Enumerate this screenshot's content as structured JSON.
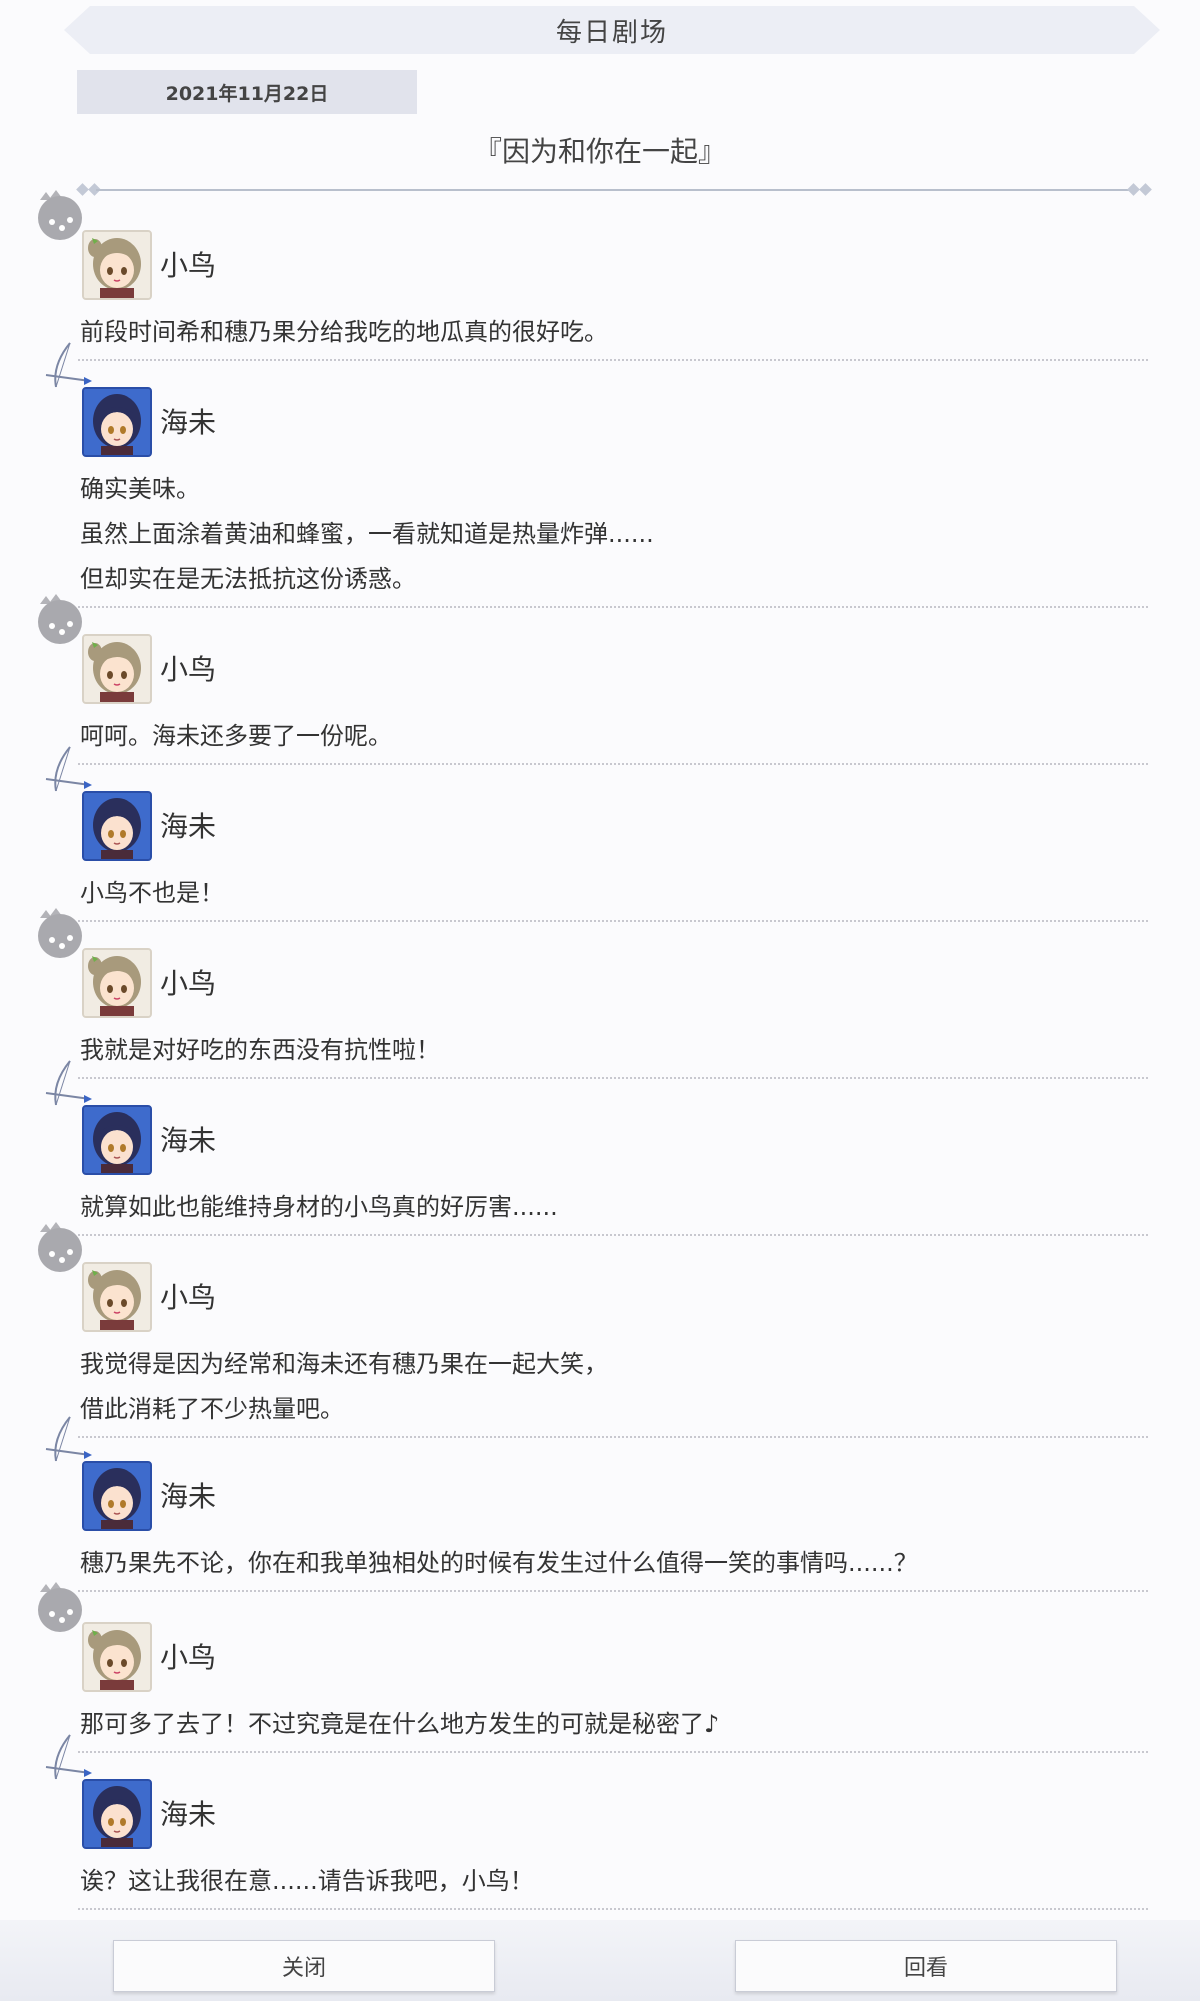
{
  "header": {
    "title": "每日剧场"
  },
  "date": "2021年11月22日",
  "story_title": "『因为和你在一起』",
  "dialogue": [
    {
      "speaker": "小鸟",
      "character": "kotori",
      "lines": [
        "前段时间希和穗乃果分给我吃的地瓜真的很好吃。"
      ]
    },
    {
      "speaker": "海未",
      "character": "umi",
      "lines": [
        "确实美味。",
        "虽然上面涂着黄油和蜂蜜，一看就知道是热量炸弹......",
        "但却实在是无法抵抗这份诱惑。"
      ]
    },
    {
      "speaker": "小鸟",
      "character": "kotori",
      "lines": [
        "呵呵。海未还多要了一份呢。"
      ]
    },
    {
      "speaker": "海未",
      "character": "umi",
      "lines": [
        "小鸟不也是！"
      ]
    },
    {
      "speaker": "小鸟",
      "character": "kotori",
      "lines": [
        "我就是对好吃的东西没有抗性啦！"
      ]
    },
    {
      "speaker": "海未",
      "character": "umi",
      "lines": [
        "就算如此也能维持身材的小鸟真的好厉害......"
      ]
    },
    {
      "speaker": "小鸟",
      "character": "kotori",
      "lines": [
        "我觉得是因为经常和海未还有穗乃果在一起大笑，",
        "借此消耗了不少热量吧。"
      ]
    },
    {
      "speaker": "海未",
      "character": "umi",
      "lines": [
        "穗乃果先不论，你在和我单独相处的时候有发生过什么值得一笑的事情吗......？"
      ]
    },
    {
      "speaker": "小鸟",
      "character": "kotori",
      "lines": [
        "那可多了去了！不过究竟是在什么地方发生的可就是秘密了♪"
      ]
    },
    {
      "speaker": "海未",
      "character": "umi",
      "lines": [
        "诶？这让我很在意......请告诉我吧，小鸟！"
      ]
    }
  ],
  "buttons": {
    "close": "关闭",
    "replay": "回看"
  },
  "colors": {
    "kotori_hair": "#a89a7c",
    "umi_hair": "#2a2f5c",
    "umi_frame": "#3a64c4"
  }
}
